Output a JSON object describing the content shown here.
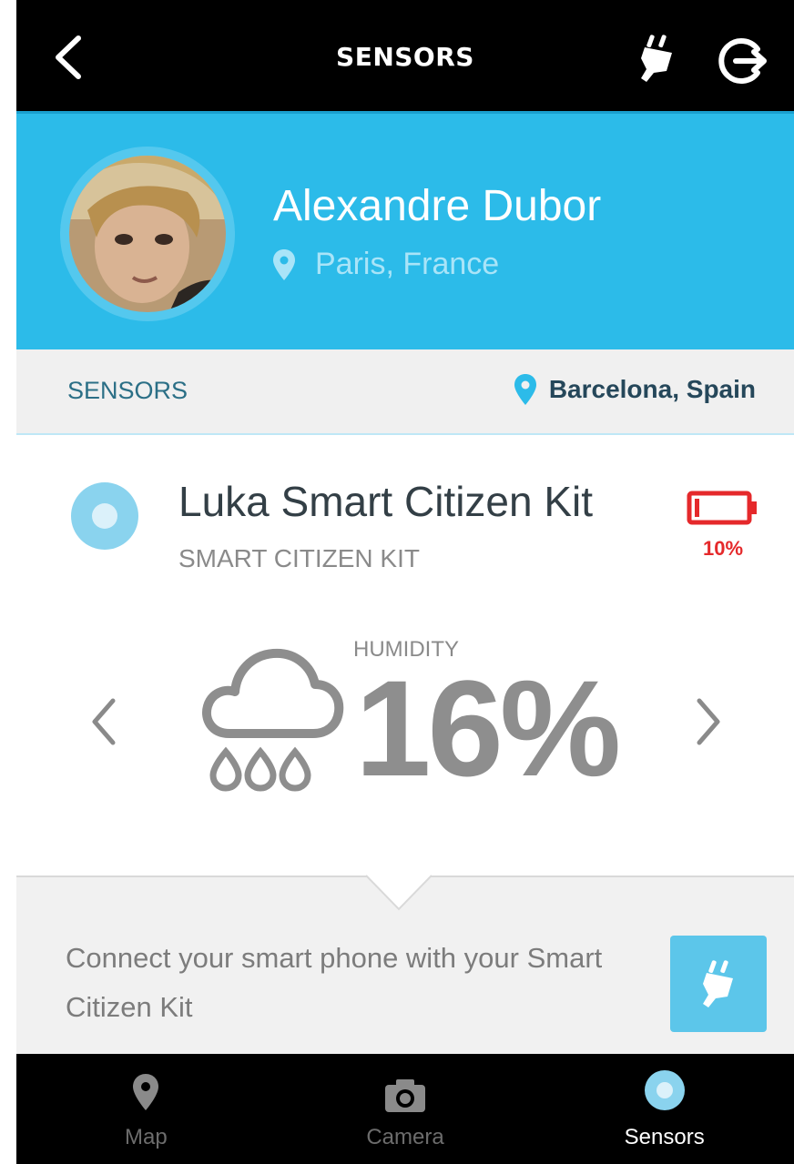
{
  "header": {
    "title": "SENSORS",
    "back_icon": "chevron-left-icon",
    "plug_icon": "plug-icon",
    "logout_icon": "logout-icon"
  },
  "profile": {
    "name": "Alexandre Dubor",
    "location": "Paris, France",
    "accent_color": "#2cbbe9"
  },
  "sensors_bar": {
    "label": "SENSORS",
    "kit_location": "Barcelona, Spain"
  },
  "kit": {
    "name": "Luka Smart Citizen Kit",
    "type": "SMART CITIZEN KIT",
    "battery": "10%",
    "battery_level": 0.1,
    "battery_color": "#e5292b"
  },
  "metric": {
    "label": "HUMIDITY",
    "value": "16%",
    "icon": "rain-cloud-icon"
  },
  "connect": {
    "text": "Connect your smart phone with your Smart Citizen Kit",
    "button_icon": "plug-icon"
  },
  "tabs": [
    {
      "label": "Map",
      "icon": "map-pin-icon",
      "active": false
    },
    {
      "label": "Camera",
      "icon": "camera-icon",
      "active": false
    },
    {
      "label": "Sensors",
      "icon": "sensors-dot-icon",
      "active": true
    }
  ]
}
